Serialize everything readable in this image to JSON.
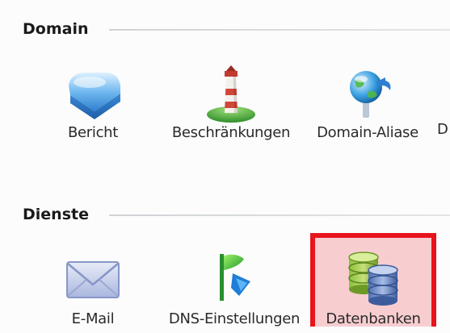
{
  "sections": {
    "domain": {
      "title": "Domain",
      "items": [
        {
          "label": "Bericht",
          "icon": "report-icon"
        },
        {
          "label": "Beschränkungen",
          "icon": "lighthouse-icon"
        },
        {
          "label": "Domain-Aliase",
          "icon": "globe-alias-icon"
        }
      ],
      "cutoff_label": "D"
    },
    "dienste": {
      "title": "Dienste",
      "items": [
        {
          "label": "E-Mail",
          "icon": "envelope-icon"
        },
        {
          "label": "DNS-Einstellungen",
          "icon": "dns-flag-icon"
        },
        {
          "label": "Datenbanken",
          "icon": "database-icon",
          "selected": true
        }
      ]
    }
  },
  "colors": {
    "selection_border": "#e8141c",
    "selection_fill": "#f7cdd0",
    "rule": "#cfd3d6"
  }
}
